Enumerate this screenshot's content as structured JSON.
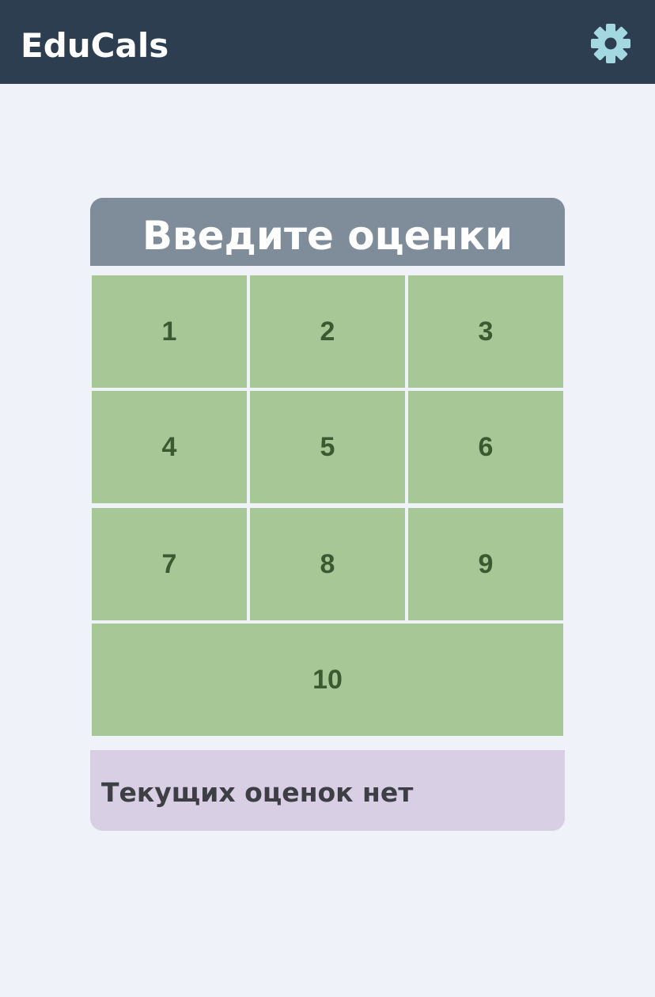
{
  "app": {
    "logo": "EduCals",
    "settings_icon": "gear-icon"
  },
  "colors": {
    "header_bg": "#2d3e51",
    "gear": "#a4d8e1",
    "title_bg": "#7f8c9a",
    "key_bg": "#a8c796",
    "key_text": "#3b5a32",
    "status_bg": "#d8cfe4"
  },
  "grades_panel": {
    "title": "Введите оценки",
    "keys": [
      "1",
      "2",
      "3",
      "4",
      "5",
      "6",
      "7",
      "8",
      "9",
      "10"
    ]
  },
  "status": {
    "text": "Текущих оценок нет"
  }
}
